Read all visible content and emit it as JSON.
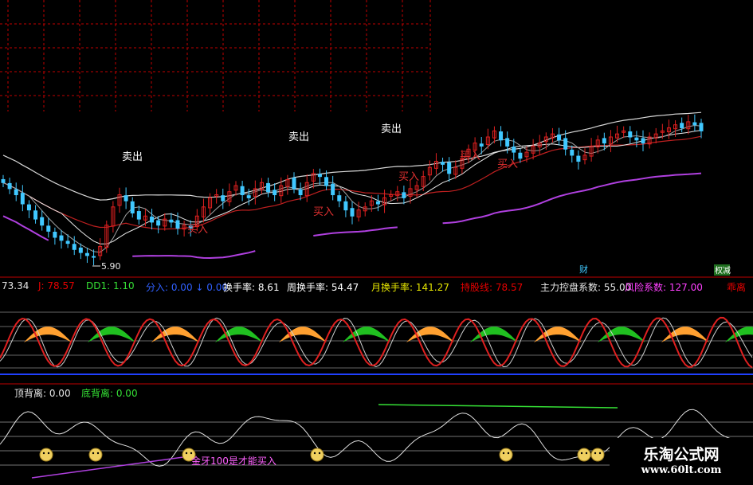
{
  "chart_data": [
    {
      "type": "candlestick",
      "annotations": {
        "sell": [
          "卖出",
          "卖出",
          "卖出"
        ],
        "buy": [
          "买入",
          "买入",
          "买入",
          "买入",
          "买入"
        ],
        "low_price": "5.90",
        "fin_tag": "财",
        "tag2": "权减"
      },
      "price_ylim": [
        5.5,
        11
      ],
      "candles_note": "daily candles, ~180 sessions",
      "close": [
        8.4,
        8.2,
        8.0,
        7.7,
        7.5,
        7.2,
        7.0,
        6.8,
        6.6,
        6.5,
        6.4,
        6.2,
        6.1,
        6.0,
        5.95,
        6.3,
        7.0,
        7.6,
        8.0,
        7.8,
        7.4,
        7.2,
        7.3,
        7.1,
        7.0,
        7.2,
        7.1,
        6.9,
        7.0,
        6.9,
        7.3,
        7.6,
        7.9,
        8.0,
        7.8,
        8.1,
        8.3,
        8.0,
        7.9,
        8.2,
        8.4,
        8.1,
        8.0,
        8.3,
        8.5,
        8.2,
        8.0,
        8.4,
        8.7,
        8.6,
        8.3,
        8.0,
        7.8,
        7.5,
        7.3,
        7.5,
        7.6,
        7.8,
        7.7,
        7.9,
        8.0,
        8.1,
        7.9,
        8.2,
        8.3,
        8.6,
        8.9,
        9.1,
        9.0,
        8.7,
        8.9,
        9.2,
        9.5,
        9.7,
        9.6,
        9.9,
        10.1,
        9.8,
        9.6,
        9.4,
        9.2,
        9.4,
        9.6,
        9.7,
        9.9,
        10.0,
        9.8,
        9.5,
        9.3,
        9.1,
        9.3,
        9.6,
        9.8,
        9.7,
        9.9,
        10.0,
        10.1,
        9.9,
        9.8,
        9.7,
        9.9,
        10.0,
        10.1,
        10.2,
        10.3,
        10.2,
        10.4,
        10.3,
        10.1
      ]
    },
    {
      "type": "line",
      "indicators": [
        {
          "key": "k_prefix",
          "text": "73.34",
          "color": "#e6e6e6"
        },
        {
          "key": "J",
          "text": "J: 78.57",
          "color": "#e60000"
        },
        {
          "key": "DD1",
          "text": "DD1: 1.10",
          "color": "#35e035"
        },
        {
          "key": "fen",
          "text": "分入: 0.00 ↓ 0.00",
          "color": "#3060ff"
        },
        {
          "key": "hsl",
          "text": "换手率: 8.61",
          "color": "#ffffff"
        },
        {
          "key": "zhsl",
          "text": "周换手率: 54.47",
          "color": "#ffffff"
        },
        {
          "key": "yhsl",
          "text": "月换手率: 141.27",
          "color": "#e6e600"
        },
        {
          "key": "cgx",
          "text": "持股线: 78.57",
          "color": "#e60000"
        },
        {
          "key": "zlkp",
          "text": "主力控盘系数: 55.00",
          "color": "#e6e6e6"
        },
        {
          "key": "fxxs",
          "text": "风险系数: 127.00",
          "color": "#ff40ff"
        },
        {
          "key": "jl",
          "text": "乖离",
          "color": "#e60000"
        }
      ]
    },
    {
      "type": "line",
      "labels": {
        "top_div": "顶背离: 0.00",
        "bot_div": "底背离: 0.00",
        "note": "金牙100是才能买入"
      }
    }
  ],
  "watermark": {
    "title": "乐淘公式网",
    "url": "www.60lt.com"
  },
  "colors": {
    "background": "#000000",
    "up": "#e02020",
    "down": "#40c8ff",
    "grid": "#c00000",
    "purple": "#b040e0",
    "orange": "#ffa030",
    "green": "#20c020"
  }
}
